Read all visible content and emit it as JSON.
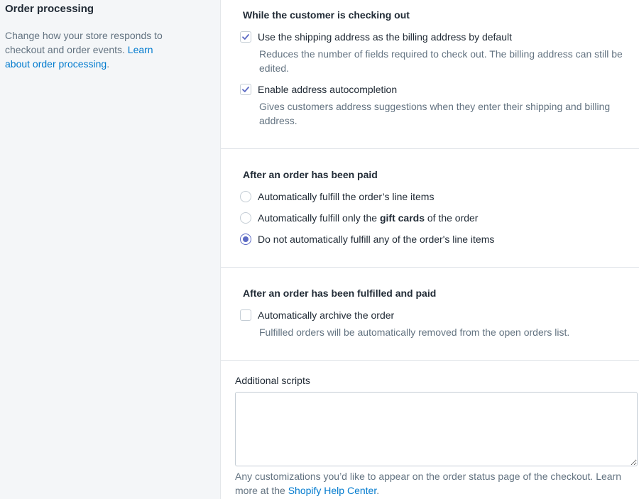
{
  "aside": {
    "title": "Order processing",
    "description": "Change how your store responds to checkout and order events. ",
    "link": "Learn about order processing",
    "link_suffix": "."
  },
  "checkout": {
    "heading": "While the customer is checking out",
    "options": [
      {
        "label": "Use the shipping address as the billing address by default",
        "help": "Reduces the number of fields required to check out. The billing address can still be edited.",
        "checked": true
      },
      {
        "label": "Enable address autocompletion",
        "help": "Gives customers address suggestions when they enter their shipping and billing address.",
        "checked": true
      }
    ]
  },
  "paid": {
    "heading": "After an order has been paid",
    "options": [
      {
        "label": "Automatically fulfill the order’s line items",
        "selected": false
      },
      {
        "label_pre": "Automatically fulfill only the ",
        "label_bold": "gift cards",
        "label_post": " of the order",
        "selected": false
      },
      {
        "label": "Do not automatically fulfill any of the order's line items",
        "selected": true
      }
    ]
  },
  "fulfilled": {
    "heading": "After an order has been fulfilled and paid",
    "option": {
      "label": "Automatically archive the order",
      "help": "Fulfilled orders will be automatically removed from the open orders list.",
      "checked": false
    }
  },
  "scripts": {
    "label": "Additional scripts",
    "value": "",
    "help_pre": "Any customizations you’d like to appear on the order status page of the checkout. Learn more at the ",
    "help_link": "Shopify Help Center",
    "help_post": "."
  },
  "colors": {
    "accent": "#5c6ac4",
    "link": "#007ace",
    "subdued": "#637381"
  }
}
